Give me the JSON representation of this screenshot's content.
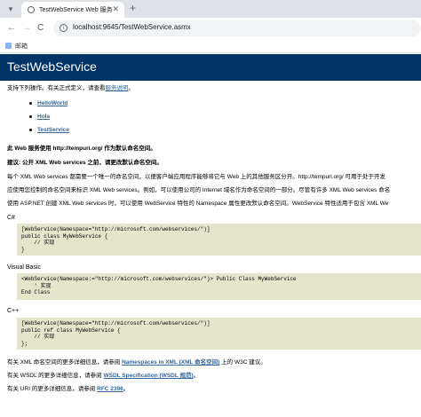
{
  "browser": {
    "tab_title": "TestWebService Web 服务",
    "tab_close": "✕",
    "new_tab": "+",
    "url": "localhost:9645/TestWebService.asmx",
    "bookmark_label": "邮箱",
    "back": "←",
    "forward": "→",
    "reload": "C"
  },
  "page": {
    "title": "TestWebService",
    "intro_prefix": "支持下列操作。有关正式定义，请查看",
    "intro_link": "服务说明",
    "intro_suffix": "。",
    "operations": [
      "HelloWorld",
      "Hola",
      "TestService"
    ],
    "namespace_notice": "此 Web 服务使用 http://tempuri.org/ 作为默认命名空间。",
    "recommendation": "建议: 公开 XML Web services 之前，请更改默认命名空间。",
    "para1_line1": "每个 XML Web services 都需要一个唯一的命名空间，以便客户端应用程序能够将它与 Web 上的其他服务区分开。http://tempuri.org/ 可用于处于开发",
    "para1_line2": "应使用您控制的命名空间来标识 XML Web services。例如，可以使用公司的 Internet 域名作为命名空间的一部分。尽管有许多 XML Web services 命名",
    "para1_line3": "使用 ASP.NET 创建 XML Web services 时，可以使用 WebService 特性的 Namespace 属性更改默认命名空间。WebService 特性适用于包含 XML We",
    "csharp_label": "C#",
    "csharp_code": "[WebService(Namespace=\"http://microsoft.com/webservices/\")]\npublic class MyWebService {\n    // 实现\n}",
    "vb_label": "Visual Basic",
    "vb_code": "<WebService(Namespace:=\"http://microsoft.com/webservices/\")> Public Class MyWebService\n    ' 实现\nEnd Class",
    "cpp_label": "C++",
    "cpp_code": "[WebService(Namespace=\"http://microsoft.com/webservices/\")]\npublic ref class MyWebService {\n    // 实现\n};",
    "footer1_prefix": "有关 XML 命名空间的更多详细信息，请参阅",
    "footer1_link": "Namespaces in XML (XML 命名空间)",
    "footer1_suffix": "上的 W3C 建议。",
    "footer2_prefix": "有关 WSDL 的更多详细信息，请参阅",
    "footer2_link": "WSDL Specification (WSDL 规范)",
    "footer2_suffix": "。",
    "footer3_prefix": "有关 URI 的更多详细信息，请参阅",
    "footer3_link": "RFC 2396",
    "footer3_suffix": "。"
  },
  "colors": {
    "heading_bg": "#003366",
    "link": "#336699",
    "code_bg": "#e5e5cc"
  }
}
